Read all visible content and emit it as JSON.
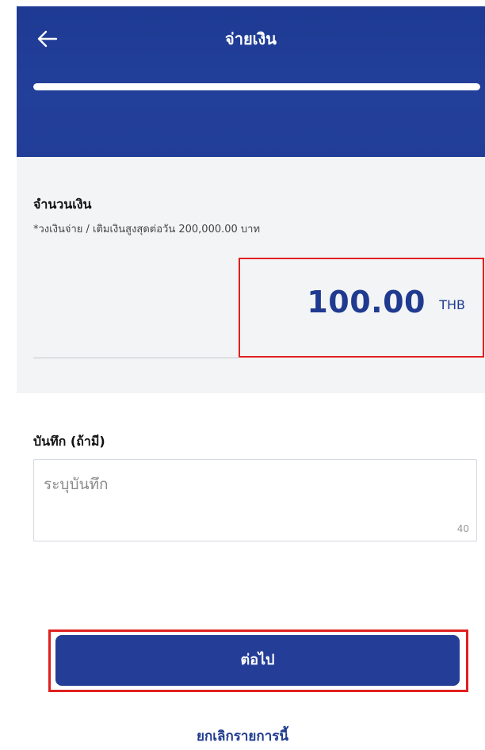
{
  "header": {
    "title": "จ่ายเงิน",
    "back_icon": "arrow-left-icon",
    "progress": 1.0
  },
  "amount": {
    "label": "จำนวนเงิน",
    "hint": "*วงเงินจ่าย / เติมเงินสูงสุดต่อวัน 200,000.00 บาท",
    "value": "100.00",
    "currency": "THB"
  },
  "note": {
    "label": "บันทึก (ถ้ามี)",
    "placeholder": "ระบุบันทึก",
    "counter": "40"
  },
  "actions": {
    "next_label": "ต่อไป",
    "cancel_label": "ยกเลิกรายการนี้"
  },
  "colors": {
    "primary": "#243e98",
    "header_bg": "#1e3a93",
    "highlight": "#e02020"
  }
}
